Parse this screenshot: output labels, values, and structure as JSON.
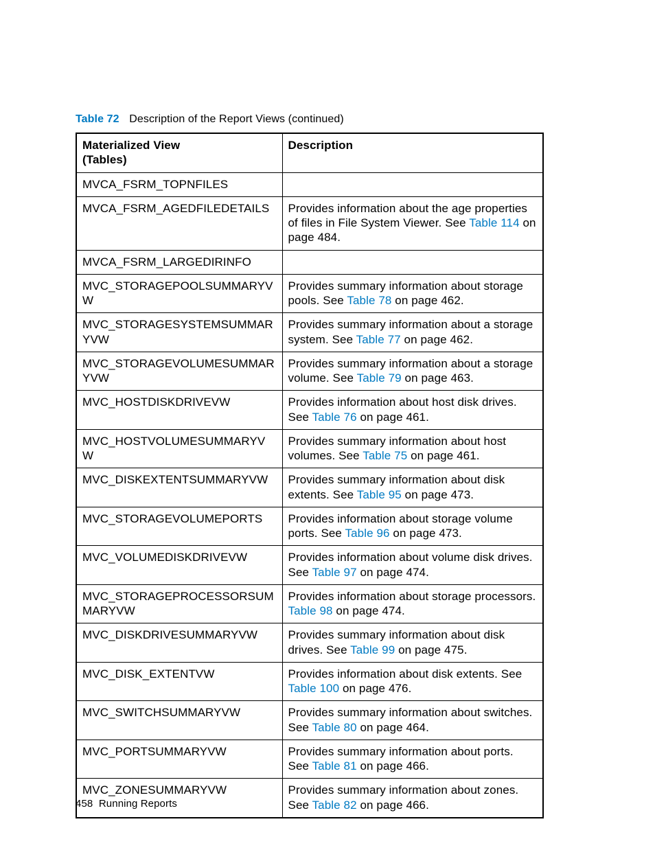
{
  "caption": {
    "label": "Table 72",
    "text": "Description of the Report Views (continued)"
  },
  "headers": {
    "col1a": "Materialized View",
    "col1b": "(Tables)",
    "col2": "Description"
  },
  "rows": [
    {
      "name": "MVCA_FSRM_TOPNFILES",
      "desc_pre": "",
      "link": "",
      "desc_post": ""
    },
    {
      "name": "MVCA_FSRM_AGEDFILEDETAILS",
      "desc_pre": "Provides information about the age properties of files in File System Viewer. See ",
      "link": "Table 114",
      "desc_post": " on page 484."
    },
    {
      "name": "MVCA_FSRM_LARGEDIRINFO",
      "desc_pre": "",
      "link": "",
      "desc_post": ""
    },
    {
      "name": "MVC_STORAGEPOOLSUMMARYVW",
      "desc_pre": "Provides summary information about storage pools. See ",
      "link": "Table 78",
      "desc_post": " on page 462."
    },
    {
      "name": "MVC_STORAGESYSTEMSUMMARYVW",
      "desc_pre": "Provides summary information about a storage system. See ",
      "link": "Table 77",
      "desc_post": " on page 462."
    },
    {
      "name": "MVC_STORAGEVOLUMESUMMARYVW",
      "desc_pre": "Provides summary information about a storage volume. See ",
      "link": "Table 79",
      "desc_post": " on page 463."
    },
    {
      "name": "MVC_HOSTDISKDRIVEVW",
      "desc_pre": "Provides information about host disk drives. See ",
      "link": "Table 76",
      "desc_post": " on page 461."
    },
    {
      "name": "MVC_HOSTVOLUMESUMMARYVW",
      "desc_pre": "Provides summary information about host volumes. See ",
      "link": "Table 75",
      "desc_post": " on page 461."
    },
    {
      "name": "MVC_DISKEXTENTSUMMARYVW",
      "desc_pre": "Provides summary information about disk extents. See ",
      "link": "Table 95",
      "desc_post": " on page 473."
    },
    {
      "name": "MVC_STORAGEVOLUMEPORTS",
      "desc_pre": "Provides information about storage volume ports. See ",
      "link": "Table 96",
      "desc_post": " on page 473."
    },
    {
      "name": "MVC_VOLUMEDISKDRIVEVW",
      "desc_pre": "Provides information about volume disk drives. See ",
      "link": "Table 97",
      "desc_post": " on page 474."
    },
    {
      "name": "MVC_STORAGEPROCESSORSUMMARYVW",
      "desc_pre": "Provides information about storage processors. ",
      "link": "Table 98",
      "desc_post": " on page 474."
    },
    {
      "name": "MVC_DISKDRIVESUMMARYVW",
      "desc_pre": "Provides summary information about disk drives. See ",
      "link": "Table 99",
      "desc_post": " on page 475."
    },
    {
      "name": "MVC_DISK_EXTENTVW",
      "desc_pre": "Provides information about disk extents. See ",
      "link": "Table 100",
      "desc_post": " on page 476."
    },
    {
      "name": "MVC_SWITCHSUMMARYVW",
      "desc_pre": "Provides summary information about switches. See ",
      "link": "Table 80",
      "desc_post": " on page 464."
    },
    {
      "name": "MVC_PORTSUMMARYVW",
      "desc_pre": "Provides summary information about ports. See ",
      "link": "Table 81",
      "desc_post": " on page 466."
    },
    {
      "name": "MVC_ZONESUMMARYVW",
      "desc_pre": "Provides summary information about zones. See ",
      "link": "Table 82",
      "desc_post": " on page 466."
    }
  ],
  "footer": {
    "page": "458",
    "section": "Running Reports"
  }
}
